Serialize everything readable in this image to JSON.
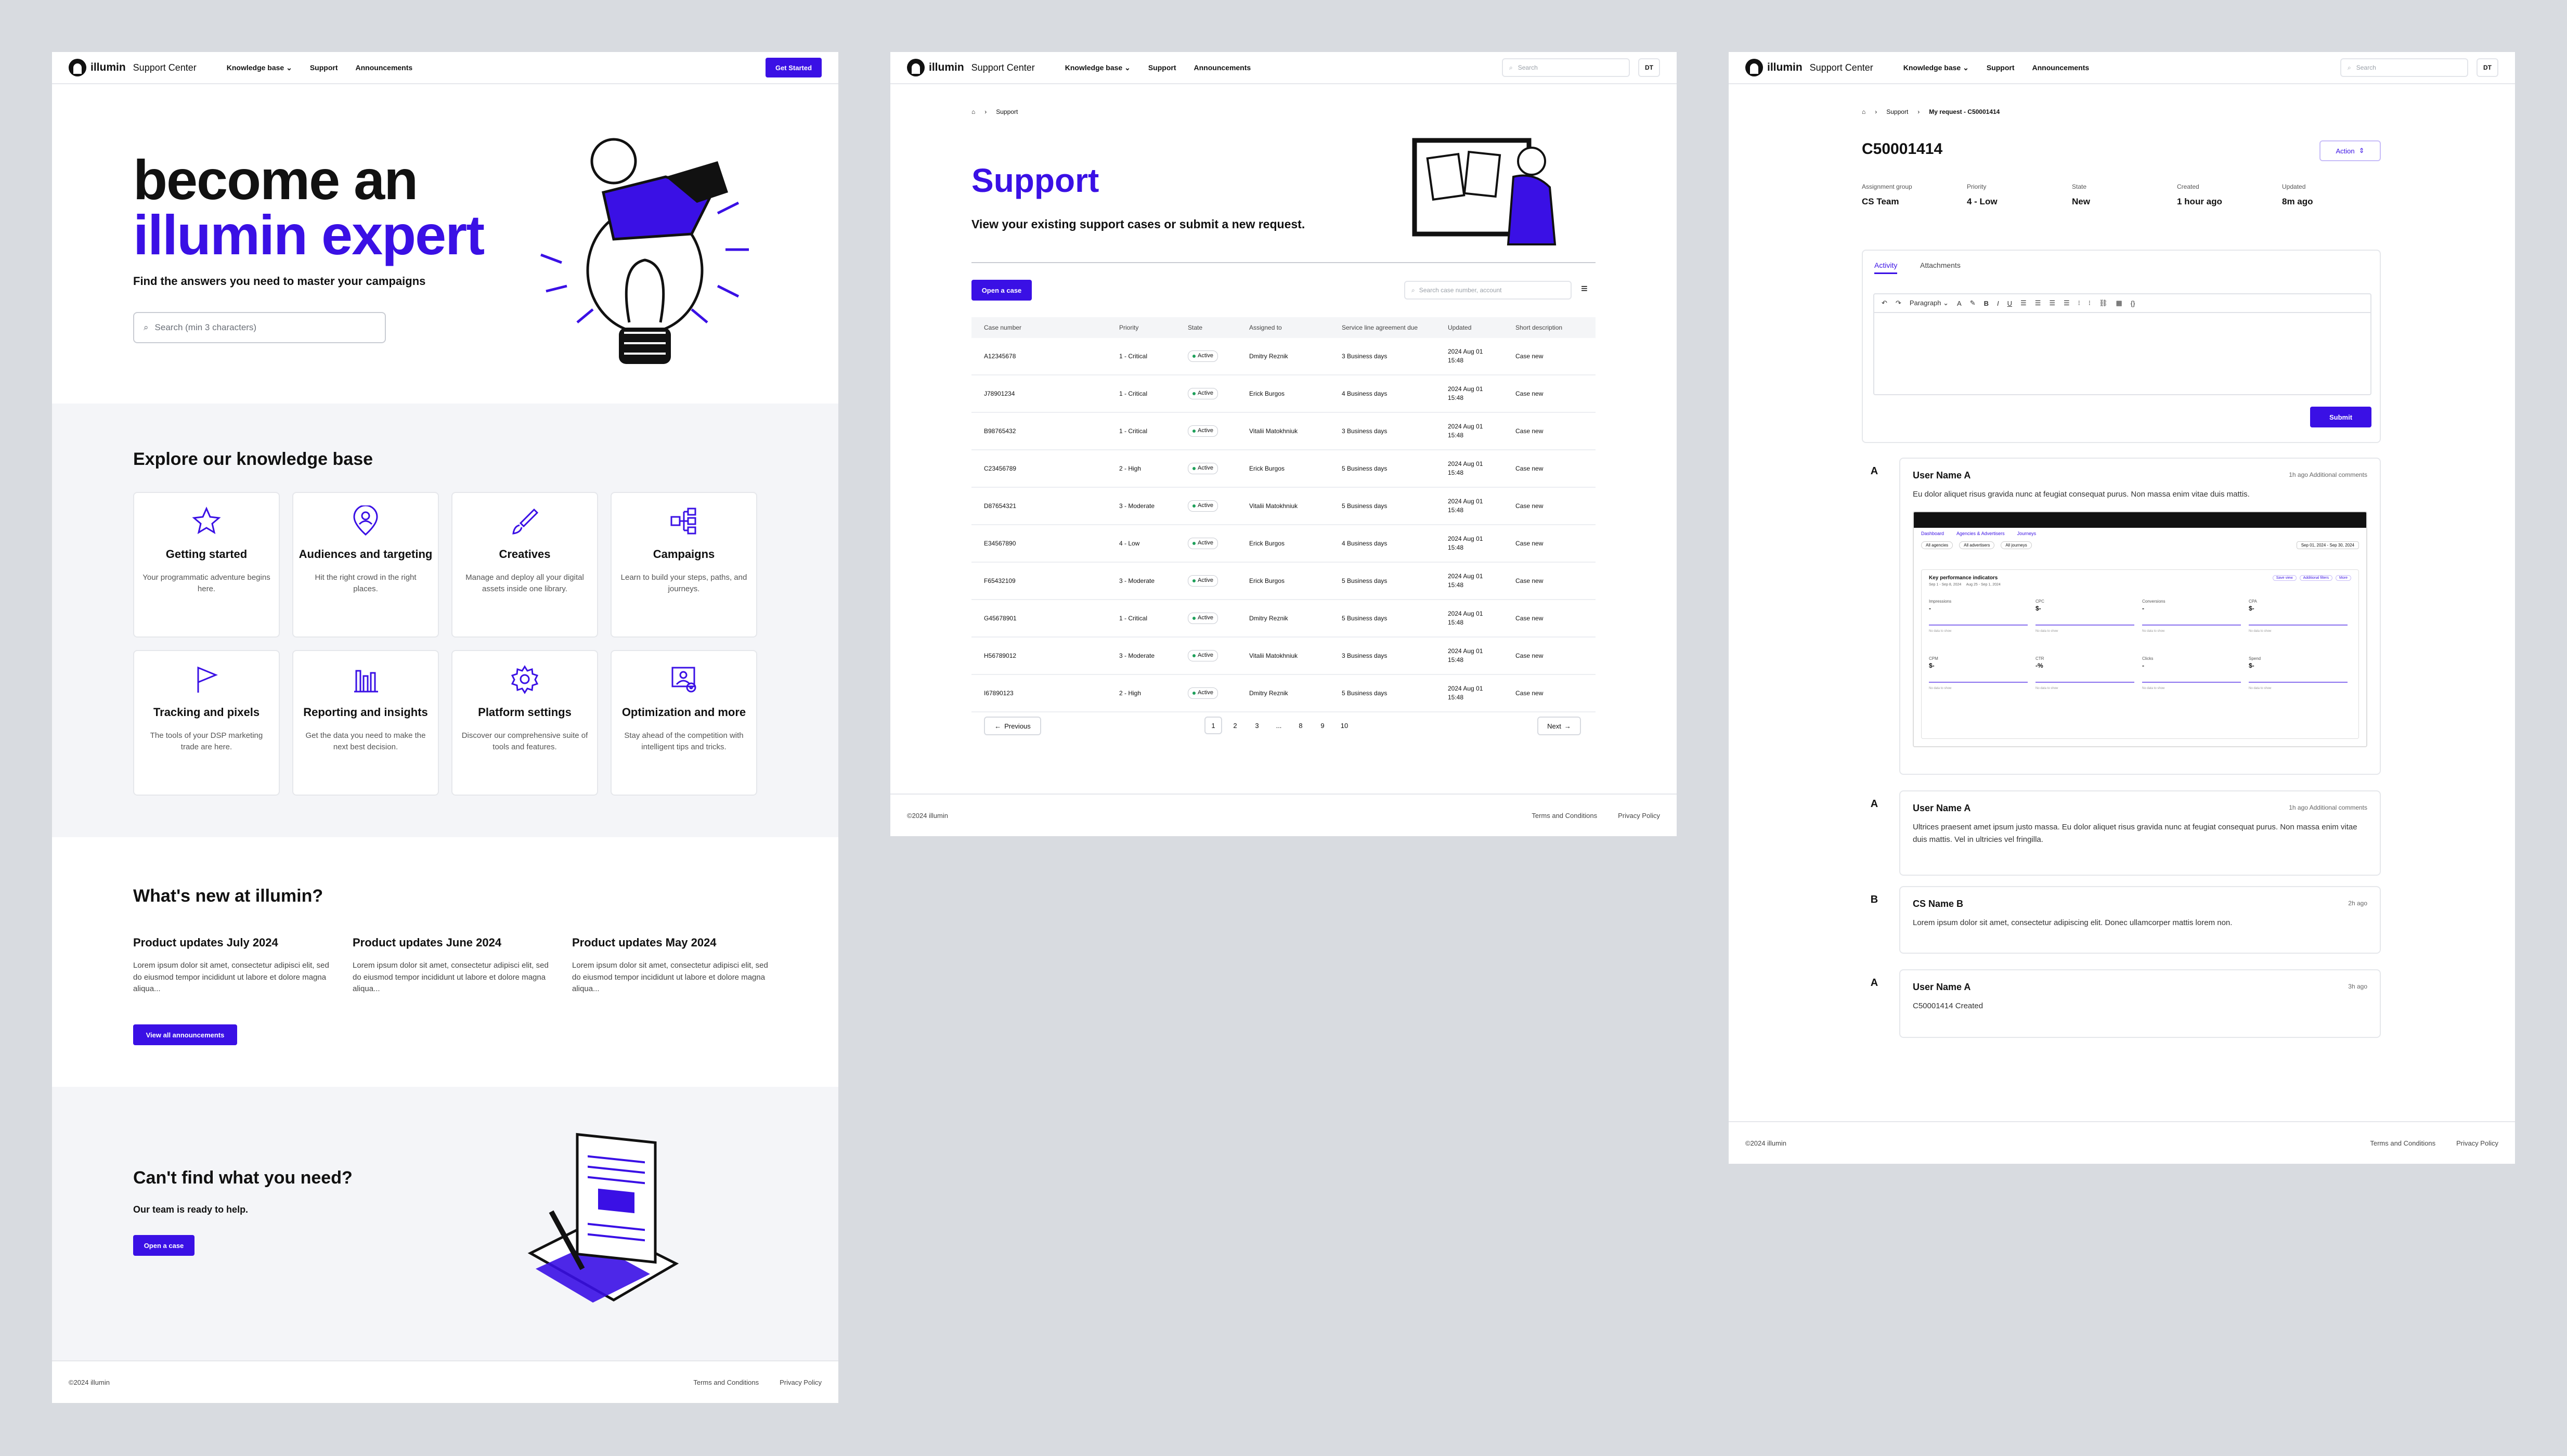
{
  "brand": {
    "name": "illumin",
    "product": "Support Center",
    "accent": "#3a10e5"
  },
  "nav": {
    "knowledge": "Knowledge base",
    "support": "Support",
    "announcements": "Announcements",
    "get_started": "Get Started",
    "search_placeholder": "Search",
    "avatar": "DT"
  },
  "home": {
    "hero_line1": "become an",
    "hero_line2": "illumin expert",
    "hero_sub": "Find the answers you need to master your campaigns",
    "search_placeholder": "Search (min 3 characters)",
    "kb_title": "Explore our knowledge base",
    "cards": [
      {
        "icon": "star-icon",
        "title": "Getting started",
        "desc": "Your programmatic adventure begins here."
      },
      {
        "icon": "location-person-icon",
        "title": "Audiences and targeting",
        "desc": "Hit the right crowd in the right places."
      },
      {
        "icon": "brush-icon",
        "title": "Creatives",
        "desc": "Manage and deploy all your digital assets inside one library."
      },
      {
        "icon": "flow-icon",
        "title": "Campaigns",
        "desc": "Learn to build your steps, paths, and journeys."
      },
      {
        "icon": "flag-icon",
        "title": "Tracking and pixels",
        "desc": "The tools of your DSP marketing trade are here."
      },
      {
        "icon": "bar-chart-icon",
        "title": "Reporting and insights",
        "desc": "Get the data you need to make the next best decision."
      },
      {
        "icon": "gear-icon",
        "title": "Platform settings",
        "desc": "Discover our comprehensive suite of tools and features."
      },
      {
        "icon": "image-eye-icon",
        "title": "Optimization and more",
        "desc": "Stay ahead of the competition with intelligent tips and tricks."
      }
    ],
    "news_title": "What's new at illumin?",
    "news": [
      {
        "title": "Product updates July 2024",
        "body": "Lorem ipsum dolor sit amet, consectetur adipisci elit, sed do eiusmod tempor incididunt ut labore et dolore magna aliqua..."
      },
      {
        "title": "Product updates June 2024",
        "body": "Lorem ipsum dolor sit amet, consectetur adipisci elit, sed do eiusmod tempor incididunt ut labore et dolore magna aliqua..."
      },
      {
        "title": "Product updates May 2024",
        "body": "Lorem ipsum dolor sit amet, consectetur adipisci elit, sed do eiusmod tempor incididunt ut labore et dolore magna aliqua..."
      }
    ],
    "view_all": "View all announcements",
    "cant_find_title": "Can't find what you need?",
    "cant_find_sub": "Our team is ready to help.",
    "open_case": "Open a case"
  },
  "support": {
    "breadcrumb": "Support",
    "title": "Support",
    "subtitle": "View your existing support cases or submit a new request.",
    "open_case": "Open a case",
    "search_placeholder": "Search case number, account",
    "columns": [
      "Case number",
      "Priority",
      "State",
      "Assigned to",
      "Service line agreement due",
      "Updated",
      "Short description"
    ],
    "rows": [
      [
        "A12345678",
        "1 - Critical",
        "Active",
        "Dmitry Reznik",
        "3 Business days",
        "2024 Aug 01 15:48",
        "Case new"
      ],
      [
        "J78901234",
        "1 - Critical",
        "Active",
        "Erick Burgos",
        "4 Business days",
        "2024 Aug 01 15:48",
        "Case new"
      ],
      [
        "B98765432",
        "1 - Critical",
        "Active",
        "Vitalii Matokhniuk",
        "3 Business days",
        "2024 Aug 01 15:48",
        "Case new"
      ],
      [
        "C23456789",
        "2 - High",
        "Active",
        "Erick Burgos",
        "5 Business days",
        "2024 Aug 01 15:48",
        "Case new"
      ],
      [
        "D87654321",
        "3 - Moderate",
        "Active",
        "Vitalii Matokhniuk",
        "5 Business days",
        "2024 Aug 01 15:48",
        "Case new"
      ],
      [
        "E34567890",
        "4 - Low",
        "Active",
        "Erick Burgos",
        "4 Business days",
        "2024 Aug 01 15:48",
        "Case new"
      ],
      [
        "F65432109",
        "3 - Moderate",
        "Active",
        "Erick Burgos",
        "5 Business days",
        "2024 Aug 01 15:48",
        "Case new"
      ],
      [
        "G45678901",
        "1 - Critical",
        "Active",
        "Dmitry Reznik",
        "5 Business days",
        "2024 Aug 01 15:48",
        "Case new"
      ],
      [
        "H56789012",
        "3 - Moderate",
        "Active",
        "Vitalii Matokhniuk",
        "3 Business days",
        "2024 Aug 01 15:48",
        "Case new"
      ],
      [
        "I67890123",
        "2 - High",
        "Active",
        "Dmitry Reznik",
        "5 Business days",
        "2024 Aug 01 15:48",
        "Case new"
      ]
    ],
    "previous": "Previous",
    "next": "Next",
    "pages": [
      "1",
      "2",
      "3",
      "...",
      "8",
      "9",
      "10"
    ]
  },
  "case": {
    "breadcrumb_support": "Support",
    "breadcrumb_current": "My request - C50001414",
    "title": "C50001414",
    "action": "Action",
    "meta": [
      {
        "label": "Assignment group",
        "value": "CS Team"
      },
      {
        "label": "Priority",
        "value": "4 - Low"
      },
      {
        "label": "State",
        "value": "New"
      },
      {
        "label": "Created",
        "value": "1 hour ago"
      },
      {
        "label": "Updated",
        "value": "8m ago"
      }
    ],
    "tab_activity": "Activity",
    "tab_attachments": "Attachments",
    "paragraph": "Paragraph",
    "submit": "Submit",
    "comments": [
      {
        "avatar": "A",
        "user": "User Name A",
        "time": "1h ago",
        "type": "Additional comments",
        "body": "Eu dolor aliquet risus gravida nunc at feugiat consequat purus. Non massa enim vitae duis mattis."
      },
      {
        "avatar": "A",
        "user": "User Name A",
        "time": "1h ago",
        "type": "Additional comments",
        "body": "Ultrices praesent amet ipsum justo massa. Eu dolor aliquet risus gravida nunc at feugiat consequat purus. Non massa enim vitae duis mattis. Vel in ultricies vel fringilla."
      },
      {
        "avatar": "B",
        "user": "CS Name B",
        "time": "2h ago",
        "type": "",
        "body": "Lorem ipsum dolor sit amet, consectetur adipiscing elit. Donec ullamcorper mattis lorem non."
      },
      {
        "avatar": "A",
        "user": "User Name A",
        "time": "3h ago",
        "type": "",
        "body": "C50001414 Created"
      }
    ],
    "shot": {
      "kpi_title": "Key performance indicators",
      "tabs": [
        "Dashboard",
        "Agencies & Advertisers",
        "Journeys"
      ],
      "chips": [
        "All agencies",
        "All advertisers",
        "All journeys"
      ],
      "date_range": "Sep 01, 2024 - Sep 30, 2024",
      "compare": "Sep 1 - Sep 8, 2024     Aug 25 - Sep 1, 2024",
      "filter_chips": [
        "Save view",
        "Additional filters",
        "More"
      ],
      "kpis": [
        {
          "label": "Impressions",
          "value": "-"
        },
        {
          "label": "CPC",
          "value": "$-"
        },
        {
          "label": "Conversions",
          "value": "-"
        },
        {
          "label": "CPA",
          "value": "$-"
        },
        {
          "label": "CPM",
          "value": "$-"
        },
        {
          "label": "CTR",
          "value": "-%"
        },
        {
          "label": "Clicks",
          "value": "-"
        },
        {
          "label": "Spend",
          "value": "$-"
        }
      ],
      "no_data": "No data to show"
    }
  },
  "footer": {
    "copyright": "©2024 illumin",
    "terms": "Terms and Conditions",
    "privacy": "Privacy Policy"
  }
}
